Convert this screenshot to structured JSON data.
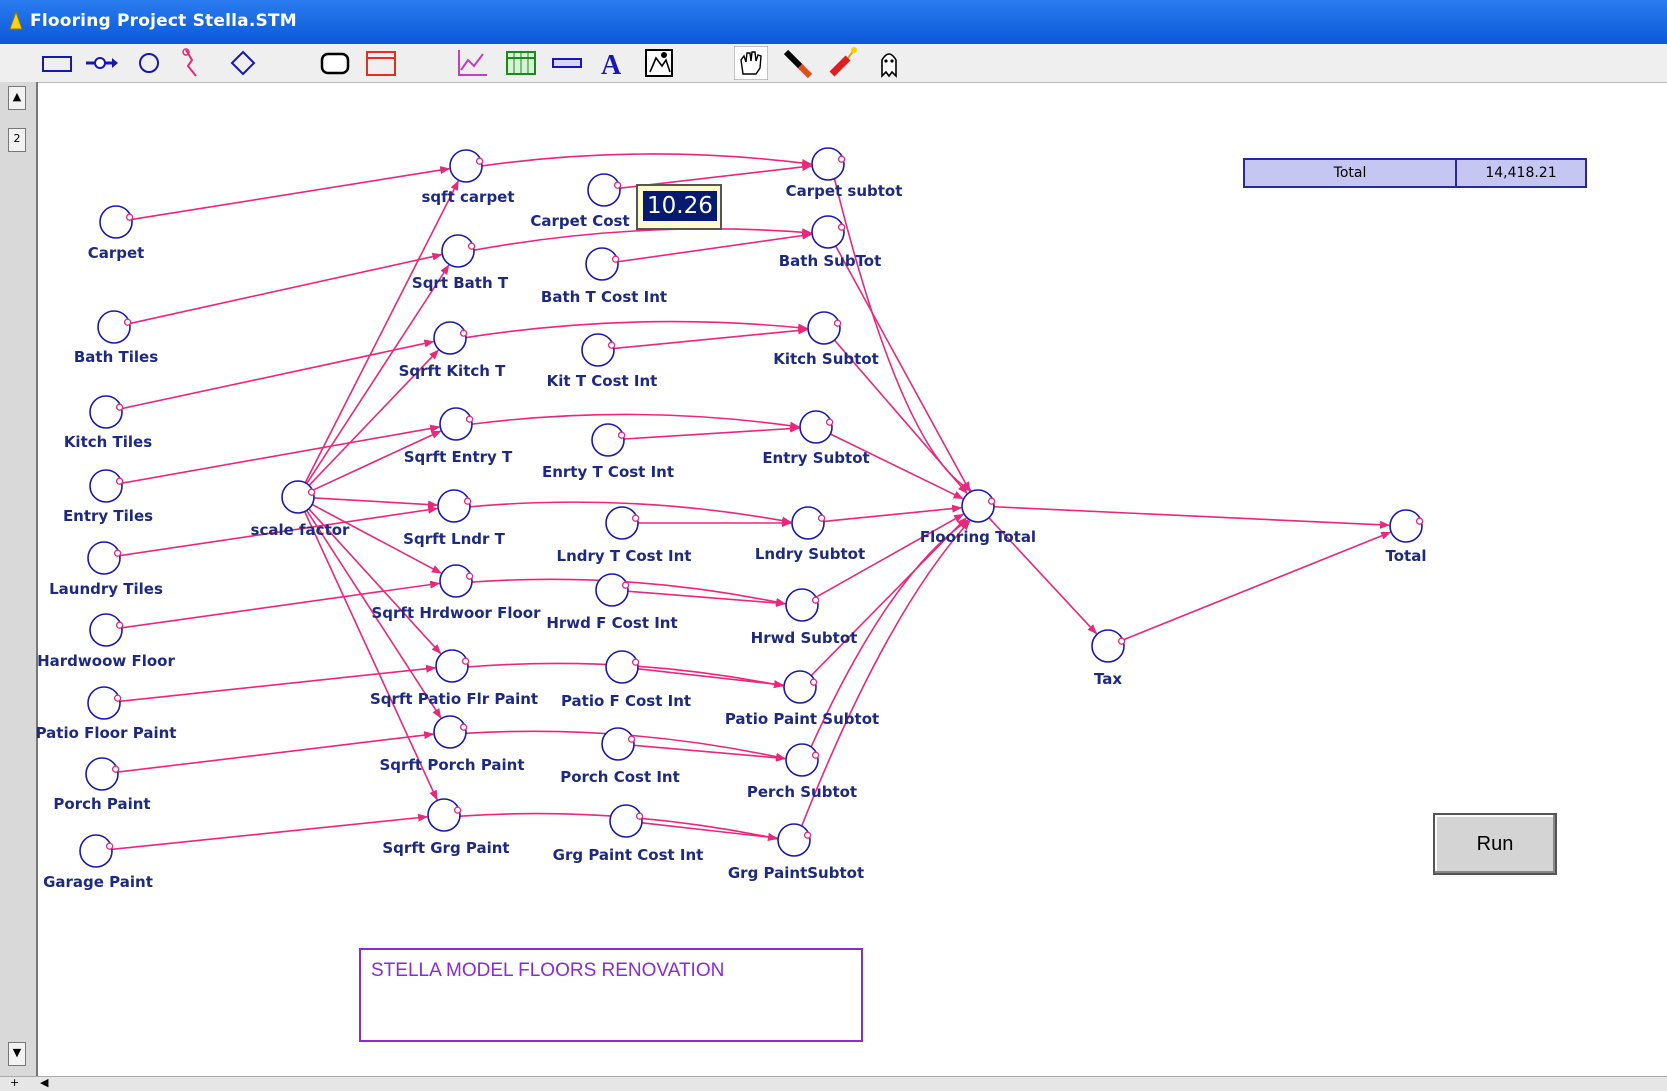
{
  "window": {
    "title": "Flooring Project Stella.STM"
  },
  "toolbar": {
    "tools": [
      {
        "name": "stock-tool-icon"
      },
      {
        "name": "flow-tool-icon"
      },
      {
        "name": "converter-tool-icon"
      },
      {
        "name": "connector-tool-icon"
      },
      {
        "name": "decision-tool-icon"
      },
      {
        "name": "button-tool-icon"
      },
      {
        "name": "sector-tool-icon"
      },
      {
        "name": "graph-pad-icon"
      },
      {
        "name": "table-pad-icon"
      },
      {
        "name": "numeric-display-icon"
      },
      {
        "name": "text-tool-icon"
      },
      {
        "name": "graphics-frame-icon"
      },
      {
        "name": "hand-tool-icon"
      },
      {
        "name": "paint-brush-icon"
      },
      {
        "name": "dynamite-icon"
      },
      {
        "name": "ghost-tool-icon"
      }
    ]
  },
  "left_panel": {
    "top_label": "2"
  },
  "diagram": {
    "inputs": [
      "Carpet",
      "Bath Tiles",
      "Kitch Tiles",
      "Entry Tiles",
      "Laundry Tiles",
      "Hardwoow Floor",
      "Patio Floor Paint",
      "Porch Paint",
      "Garage Paint"
    ],
    "scale": "scale factor",
    "sqft": [
      "sqft carpet",
      "Sqrt Bath T",
      "Sqrft Kitch T",
      "Sqrft Entry T",
      "Sqrft Lndr T",
      "Sqrft Hrdwoor Floor",
      "Sqrft Patio Flr Paint",
      "Sqrft Porch Paint",
      "Sqrft Grg Paint"
    ],
    "costs": [
      "Carpet Cost",
      "Bath T Cost Int",
      "Kit T Cost Int",
      "Enrty T Cost Int",
      "Lndry T Cost Int",
      "Hrwd F Cost Int",
      "Patio F Cost Int",
      "Porch Cost Int",
      "Grg Paint Cost Int"
    ],
    "subtotals": [
      "Carpet subtot",
      "Bath SubTot",
      "Kitch Subtot",
      "Entry Subtot",
      "Lndry Subtot",
      "Hrwd Subtot",
      "Patio Paint Subtot",
      "Perch Subtot",
      "Grg PaintSubtot"
    ],
    "flooring_total": "Flooring Total",
    "tax": "Tax",
    "total": "Total",
    "connector_color": "#e8287a",
    "node_color": "#1818b0"
  },
  "tooltip": {
    "value": "10.26"
  },
  "total_display": {
    "label": "Total",
    "value": "14,418.21"
  },
  "run_button": {
    "label": "Run"
  },
  "model_title": {
    "text": "STELLA  MODEL FLOORS RENOVATION"
  }
}
